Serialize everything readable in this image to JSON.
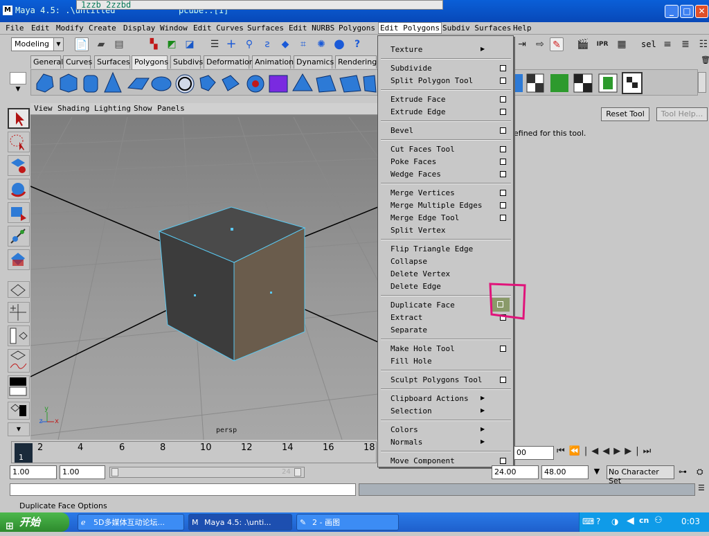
{
  "window": {
    "title": "Maya 4.5: .\\untitled",
    "overlay_text": "1zzb 2zzbd",
    "overlay_faded": "pcube..[1]"
  },
  "menubar": [
    "File",
    "Edit",
    "Modify",
    "Create",
    "Display",
    "Window",
    "Edit Curves",
    "Surfaces",
    "Edit NURBS",
    "Polygons",
    "Edit Polygons",
    "Subdiv Surfaces",
    "Help"
  ],
  "toolbar": {
    "mode": "Modeling",
    "sel_label": "sel"
  },
  "shelf_tabs": [
    "General",
    "Curves",
    "Surfaces",
    "Polygons",
    "Subdivs",
    "Deformation",
    "Animation",
    "Dynamics",
    "Rendering"
  ],
  "shelf_active": "Polygons",
  "panel_menu": [
    "View",
    "Shading",
    "Lighting",
    "Show",
    "Panels"
  ],
  "viewport": {
    "camera": "persp",
    "axis_y": "y",
    "axis_z": "z",
    "axis_x": "x"
  },
  "tool_settings": {
    "reset": "Reset Tool",
    "help": "Tool Help...",
    "message": "efined for this tool."
  },
  "dropdown": {
    "groups": [
      [
        {
          "label": "Texture",
          "submenu": true
        }
      ],
      [
        {
          "label": "Subdivide",
          "option": true
        },
        {
          "label": "Split Polygon Tool",
          "option": true
        }
      ],
      [
        {
          "label": "Extrude Face",
          "option": true
        },
        {
          "label": "Extrude Edge",
          "option": true
        }
      ],
      [
        {
          "label": "Bevel",
          "option": true
        }
      ],
      [
        {
          "label": "Cut Faces Tool",
          "option": true
        },
        {
          "label": "Poke Faces",
          "option": true
        },
        {
          "label": "Wedge Faces",
          "option": true
        }
      ],
      [
        {
          "label": "Merge Vertices",
          "option": true
        },
        {
          "label": "Merge Multiple Edges",
          "option": true
        },
        {
          "label": "Merge Edge Tool",
          "option": true
        },
        {
          "label": "Split Vertex"
        }
      ],
      [
        {
          "label": "Flip Triangle Edge"
        },
        {
          "label": "Collapse"
        },
        {
          "label": "Delete Vertex"
        },
        {
          "label": "Delete Edge"
        }
      ],
      [
        {
          "label": "Duplicate Face",
          "option": true,
          "highlighted": true
        },
        {
          "label": "Extract",
          "option": true
        },
        {
          "label": "Separate"
        }
      ],
      [
        {
          "label": "Make Hole Tool",
          "option": true
        },
        {
          "label": "Fill Hole"
        }
      ],
      [
        {
          "label": "Sculpt Polygons Tool",
          "option": true
        }
      ],
      [
        {
          "label": "Clipboard Actions",
          "submenu": true
        },
        {
          "label": "Selection",
          "submenu": true
        }
      ],
      [
        {
          "label": "Colors",
          "submenu": true
        },
        {
          "label": "Normals",
          "submenu": true
        }
      ],
      [
        {
          "label": "Move Component",
          "option": true
        }
      ]
    ]
  },
  "timeline": {
    "ticks": [
      "2",
      "4",
      "6",
      "8",
      "10",
      "12",
      "14",
      "16",
      "18"
    ],
    "current_frame": "1",
    "current_frame_field": "00"
  },
  "range": {
    "start": "1.00",
    "playback_start": "1.00",
    "slider_end_label": "24",
    "playback_end": "24.00",
    "end": "48.00",
    "character_set": "No Character Set"
  },
  "helpline": "Duplicate Face Options",
  "taskbar": {
    "start": "开始",
    "items": [
      "5D多媒体互动论坛...",
      "Maya 4.5: .\\unti...",
      "2 - 画图"
    ],
    "clock": "0:03"
  },
  "colors": {
    "accent_highlight": "#e0147a",
    "cube_edge": "#5ac8f0"
  }
}
